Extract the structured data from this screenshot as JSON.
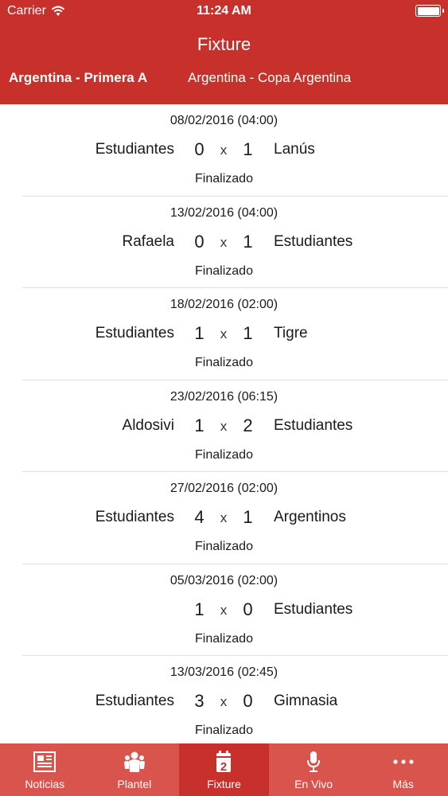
{
  "status_bar": {
    "carrier": "Carrier",
    "time": "11:24 AM"
  },
  "nav": {
    "title": "Fixture"
  },
  "league_tabs": [
    {
      "label": "Argentina - Primera A",
      "active": true
    },
    {
      "label": "Argentina - Copa Argentina",
      "active": false
    }
  ],
  "matches": [
    {
      "date": "08/02/2016 (04:00)",
      "home": "Estudiantes",
      "home_score": "0",
      "sep": "x",
      "away_score": "1",
      "away": "Lanús",
      "status": "Finalizado"
    },
    {
      "date": "13/02/2016 (04:00)",
      "home": "Rafaela",
      "home_score": "0",
      "sep": "x",
      "away_score": "1",
      "away": "Estudiantes",
      "status": "Finalizado"
    },
    {
      "date": "18/02/2016 (02:00)",
      "home": "Estudiantes",
      "home_score": "1",
      "sep": "x",
      "away_score": "1",
      "away": "Tigre",
      "status": "Finalizado"
    },
    {
      "date": "23/02/2016 (06:15)",
      "home": "Aldosivi",
      "home_score": "1",
      "sep": "x",
      "away_score": "2",
      "away": "Estudiantes",
      "status": "Finalizado"
    },
    {
      "date": "27/02/2016 (02:00)",
      "home": "Estudiantes",
      "home_score": "4",
      "sep": "x",
      "away_score": "1",
      "away": "Argentinos",
      "status": "Finalizado"
    },
    {
      "date": "05/03/2016 (02:00)",
      "home": "",
      "home_score": "1",
      "sep": "x",
      "away_score": "0",
      "away": "Estudiantes",
      "status": "Finalizado"
    },
    {
      "date": "13/03/2016 (02:45)",
      "home": "Estudiantes",
      "home_score": "3",
      "sep": "x",
      "away_score": "0",
      "away": "Gimnasia",
      "status": "Finalizado"
    }
  ],
  "tabbar": [
    {
      "label": "Noticias",
      "icon": "newspaper-icon"
    },
    {
      "label": "Plantel",
      "icon": "team-icon"
    },
    {
      "label": "Fixture",
      "icon": "calendar-icon",
      "calendar_day": "2",
      "active": true
    },
    {
      "label": "En Vivo",
      "icon": "microphone-icon"
    },
    {
      "label": "Más",
      "icon": "more-icon"
    }
  ],
  "colors": {
    "primary": "#c8302b",
    "tabbar": "#d9544d",
    "text": "#1a1a1a",
    "separator": "#dedede"
  }
}
